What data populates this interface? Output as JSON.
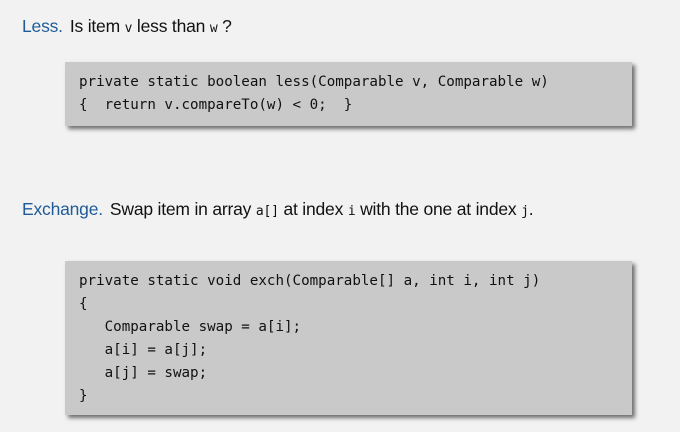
{
  "less": {
    "term": "Less.",
    "text_parts": [
      "Is item ",
      "v",
      " less than ",
      "w",
      " ?"
    ],
    "code": [
      "private static boolean less(Comparable v, Comparable w)",
      "{  return v.compareTo(w) < 0;  }"
    ]
  },
  "exchange": {
    "term": "Exchange.",
    "text_parts": [
      "Swap item in array ",
      "a[]",
      " at index ",
      "i",
      " with the one at index ",
      "j",
      "."
    ],
    "code": [
      "private static void exch(Comparable[] a, int i, int j)",
      "{",
      "   Comparable swap = a[i];",
      "   a[i] = a[j];",
      "   a[j] = swap;",
      "}"
    ]
  },
  "colors": {
    "term": "#1f5c99",
    "background": "#f2f2f2",
    "codebox": "#c9c9c9"
  }
}
